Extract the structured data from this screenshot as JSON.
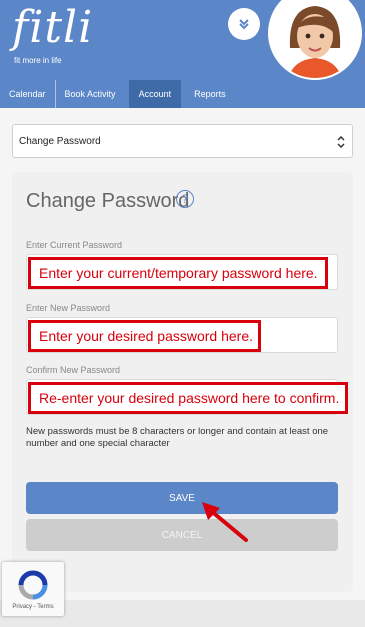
{
  "header": {
    "logo_text": "fitli",
    "logo_tagline": "fit more in life",
    "tabs": [
      {
        "label": "Calendar"
      },
      {
        "label": "Book Activity"
      },
      {
        "label": "Account"
      },
      {
        "label": "Reports"
      }
    ],
    "active_tab": "Account",
    "brand_color": "#5b86c8"
  },
  "select": {
    "value": "Change Password"
  },
  "form": {
    "title": "Change Password",
    "current_label": "Enter Current Password",
    "current_callout": "Enter your current/temporary password here.",
    "new_label": "Enter New Password",
    "new_callout": "Enter your desired password here.",
    "confirm_label": "Confirm New Password",
    "confirm_callout": "Re-enter your desired password here to confirm.",
    "hint": "New passwords must be 8 characters or longer and contain at least one number and one special character",
    "save_label": "SAVE",
    "cancel_label": "CANCEL"
  },
  "recaptcha": {
    "links": "Privacy - Terms"
  },
  "annotation_color": "#d8000c"
}
